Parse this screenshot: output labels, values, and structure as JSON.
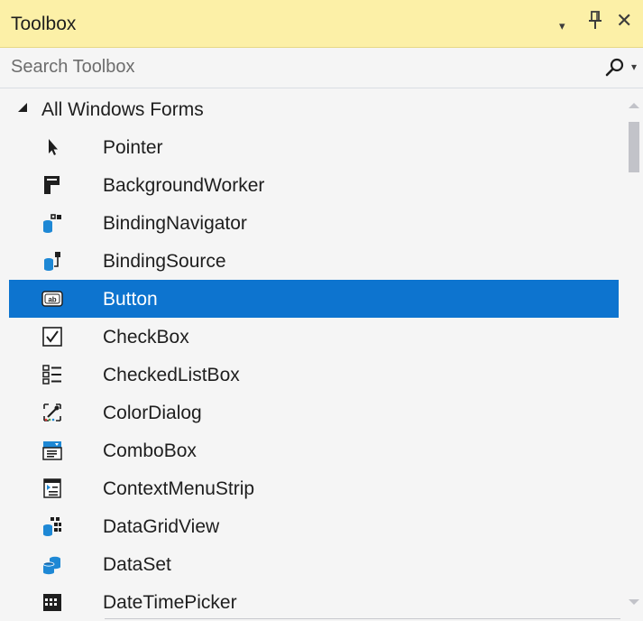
{
  "toolbox": {
    "title": "Toolbox",
    "dropdown_glyph": "▾",
    "pin_glyph": "ᛘ",
    "close_glyph": "✕"
  },
  "search": {
    "placeholder": "Search Toolbox",
    "value": "",
    "dropdown_glyph": "▾"
  },
  "group": {
    "label": "All Windows Forms",
    "expanded": true
  },
  "items": [
    {
      "label": "Pointer",
      "icon": "pointer-icon"
    },
    {
      "label": "BackgroundWorker",
      "icon": "background-worker-icon"
    },
    {
      "label": "BindingNavigator",
      "icon": "binding-navigator-icon"
    },
    {
      "label": "BindingSource",
      "icon": "binding-source-icon"
    },
    {
      "label": "Button",
      "icon": "button-icon",
      "selected": true
    },
    {
      "label": "CheckBox",
      "icon": "checkbox-icon"
    },
    {
      "label": "CheckedListBox",
      "icon": "checked-list-box-icon"
    },
    {
      "label": "ColorDialog",
      "icon": "color-dialog-icon"
    },
    {
      "label": "ComboBox",
      "icon": "combobox-icon"
    },
    {
      "label": "ContextMenuStrip",
      "icon": "context-menu-strip-icon"
    },
    {
      "label": "DataGridView",
      "icon": "data-grid-view-icon"
    },
    {
      "label": "DataSet",
      "icon": "dataset-icon"
    },
    {
      "label": "DateTimePicker",
      "icon": "date-time-picker-icon"
    }
  ],
  "colors": {
    "titlebar": "#fcf0a7",
    "selected": "#0d74cf",
    "icon_blue": "#1e88d5",
    "icon_dark": "#1e1e1e"
  }
}
